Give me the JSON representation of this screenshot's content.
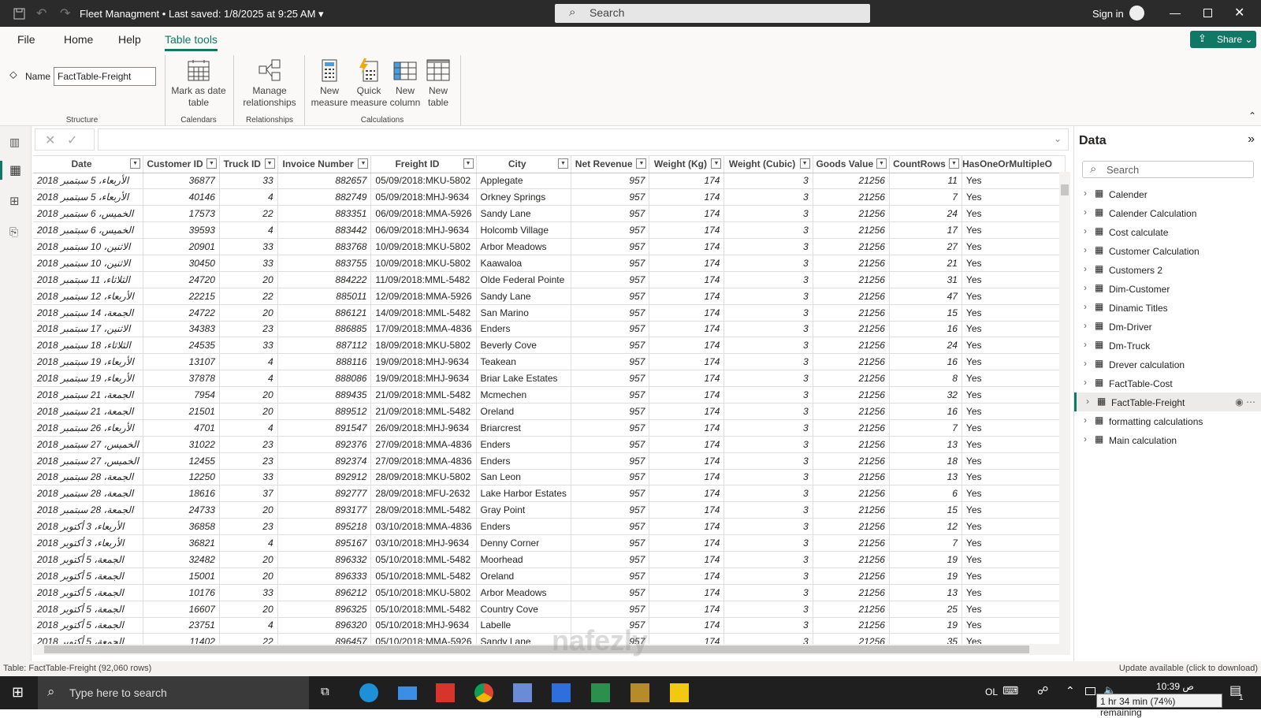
{
  "title": {
    "doc": "Fleet Managment",
    "saved": "• Last saved: 1/8/2025 at 9:25 AM",
    "search": "Search",
    "sign_in": "Sign in"
  },
  "ribbon": {
    "tabs": [
      "File",
      "Home",
      "Help",
      "Table tools"
    ],
    "active_tab": "Table tools",
    "name_label": "Name",
    "name_value": "FactTable-Freight",
    "buttons": [
      {
        "l1": "Mark as date",
        "l2": "table"
      },
      {
        "l1": "Manage",
        "l2": "relationships"
      },
      {
        "l1": "New",
        "l2": "measure"
      },
      {
        "l1": "Quick",
        "l2": "measure"
      },
      {
        "l1": "New",
        "l2": "column"
      },
      {
        "l1": "New",
        "l2": "table"
      }
    ],
    "groups": [
      "Structure",
      "Calendars",
      "Relationships",
      "Calculations"
    ],
    "share": "Share"
  },
  "table": {
    "columns": [
      "Date",
      "Customer ID",
      "Truck ID",
      "Invoice Number",
      "Freight ID",
      "City",
      "Net Revenue",
      "Weight (Kg)",
      "Weight (Cubic)",
      "Goods Value",
      "CountRows",
      "HasOneOrMultipleO"
    ],
    "rows": [
      [
        "الأربعاء، 5 سبتمبر 2018",
        "36877",
        "33",
        "882657",
        "05/09/2018:MKU-5802",
        "Applegate",
        "957",
        "174",
        "3",
        "21256",
        "11",
        "Yes"
      ],
      [
        "الأربعاء، 5 سبتمبر 2018",
        "40146",
        "4",
        "882749",
        "05/09/2018:MHJ-9634",
        "Orkney Springs",
        "957",
        "174",
        "3",
        "21256",
        "7",
        "Yes"
      ],
      [
        "الخميس، 6 سبتمبر 2018",
        "17573",
        "22",
        "883351",
        "06/09/2018:MMA-5926",
        "Sandy Lane",
        "957",
        "174",
        "3",
        "21256",
        "24",
        "Yes"
      ],
      [
        "الخميس، 6 سبتمبر 2018",
        "39593",
        "4",
        "883442",
        "06/09/2018:MHJ-9634",
        "Holcomb Village",
        "957",
        "174",
        "3",
        "21256",
        "17",
        "Yes"
      ],
      [
        "الاثنين، 10 سبتمبر 2018",
        "20901",
        "33",
        "883768",
        "10/09/2018:MKU-5802",
        "Arbor Meadows",
        "957",
        "174",
        "3",
        "21256",
        "27",
        "Yes"
      ],
      [
        "الاثنين، 10 سبتمبر 2018",
        "30450",
        "33",
        "883755",
        "10/09/2018:MKU-5802",
        "Kaawaloa",
        "957",
        "174",
        "3",
        "21256",
        "21",
        "Yes"
      ],
      [
        "الثلاثاء، 11 سبتمبر 2018",
        "24720",
        "20",
        "884222",
        "11/09/2018:MML-5482",
        "Olde Federal Pointe",
        "957",
        "174",
        "3",
        "21256",
        "31",
        "Yes"
      ],
      [
        "الأربعاء، 12 سبتمبر 2018",
        "22215",
        "22",
        "885011",
        "12/09/2018:MMA-5926",
        "Sandy Lane",
        "957",
        "174",
        "3",
        "21256",
        "47",
        "Yes"
      ],
      [
        "الجمعة، 14 سبتمبر 2018",
        "24722",
        "20",
        "886121",
        "14/09/2018:MML-5482",
        "San Marino",
        "957",
        "174",
        "3",
        "21256",
        "15",
        "Yes"
      ],
      [
        "الاثنين، 17 سبتمبر 2018",
        "34383",
        "23",
        "886885",
        "17/09/2018:MMA-4836",
        "Enders",
        "957",
        "174",
        "3",
        "21256",
        "16",
        "Yes"
      ],
      [
        "الثلاثاء، 18 سبتمبر 2018",
        "24535",
        "33",
        "887112",
        "18/09/2018:MKU-5802",
        "Beverly Cove",
        "957",
        "174",
        "3",
        "21256",
        "24",
        "Yes"
      ],
      [
        "الأربعاء، 19 سبتمبر 2018",
        "13107",
        "4",
        "888116",
        "19/09/2018:MHJ-9634",
        "Teakean",
        "957",
        "174",
        "3",
        "21256",
        "16",
        "Yes"
      ],
      [
        "الأربعاء، 19 سبتمبر 2018",
        "37878",
        "4",
        "888086",
        "19/09/2018:MHJ-9634",
        "Briar Lake Estates",
        "957",
        "174",
        "3",
        "21256",
        "8",
        "Yes"
      ],
      [
        "الجمعة، 21 سبتمبر 2018",
        "7954",
        "20",
        "889435",
        "21/09/2018:MML-5482",
        "Mcmechen",
        "957",
        "174",
        "3",
        "21256",
        "32",
        "Yes"
      ],
      [
        "الجمعة، 21 سبتمبر 2018",
        "21501",
        "20",
        "889512",
        "21/09/2018:MML-5482",
        "Oreland",
        "957",
        "174",
        "3",
        "21256",
        "16",
        "Yes"
      ],
      [
        "الأربعاء، 26 سبتمبر 2018",
        "4701",
        "4",
        "891547",
        "26/09/2018:MHJ-9634",
        "Briarcrest",
        "957",
        "174",
        "3",
        "21256",
        "7",
        "Yes"
      ],
      [
        "الخميس، 27 سبتمبر 2018",
        "31022",
        "23",
        "892376",
        "27/09/2018:MMA-4836",
        "Enders",
        "957",
        "174",
        "3",
        "21256",
        "13",
        "Yes"
      ],
      [
        "الخميس، 27 سبتمبر 2018",
        "12455",
        "23",
        "892374",
        "27/09/2018:MMA-4836",
        "Enders",
        "957",
        "174",
        "3",
        "21256",
        "18",
        "Yes"
      ],
      [
        "الجمعة، 28 سبتمبر 2018",
        "12250",
        "33",
        "892912",
        "28/09/2018:MKU-5802",
        "San Leon",
        "957",
        "174",
        "3",
        "21256",
        "13",
        "Yes"
      ],
      [
        "الجمعة، 28 سبتمبر 2018",
        "18616",
        "37",
        "892777",
        "28/09/2018:MFU-2632",
        "Lake Harbor Estates",
        "957",
        "174",
        "3",
        "21256",
        "6",
        "Yes"
      ],
      [
        "الجمعة، 28 سبتمبر 2018",
        "24733",
        "20",
        "893177",
        "28/09/2018:MML-5482",
        "Gray Point",
        "957",
        "174",
        "3",
        "21256",
        "15",
        "Yes"
      ],
      [
        "الأربعاء، 3 أكتوبر 2018",
        "36858",
        "23",
        "895218",
        "03/10/2018:MMA-4836",
        "Enders",
        "957",
        "174",
        "3",
        "21256",
        "12",
        "Yes"
      ],
      [
        "الأربعاء، 3 أكتوبر 2018",
        "36821",
        "4",
        "895167",
        "03/10/2018:MHJ-9634",
        "Denny Corner",
        "957",
        "174",
        "3",
        "21256",
        "7",
        "Yes"
      ],
      [
        "الجمعة، 5 أكتوبر 2018",
        "32482",
        "20",
        "896332",
        "05/10/2018:MML-5482",
        "Moorhead",
        "957",
        "174",
        "3",
        "21256",
        "19",
        "Yes"
      ],
      [
        "الجمعة، 5 أكتوبر 2018",
        "15001",
        "20",
        "896333",
        "05/10/2018:MML-5482",
        "Oreland",
        "957",
        "174",
        "3",
        "21256",
        "19",
        "Yes"
      ],
      [
        "الجمعة، 5 أكتوبر 2018",
        "10176",
        "33",
        "896212",
        "05/10/2018:MKU-5802",
        "Arbor Meadows",
        "957",
        "174",
        "3",
        "21256",
        "13",
        "Yes"
      ],
      [
        "الجمعة، 5 أكتوبر 2018",
        "16607",
        "20",
        "896325",
        "05/10/2018:MML-5482",
        "Country Cove",
        "957",
        "174",
        "3",
        "21256",
        "25",
        "Yes"
      ],
      [
        "الجمعة، 5 أكتوبر 2018",
        "23751",
        "4",
        "896320",
        "05/10/2018:MHJ-9634",
        "Labelle",
        "957",
        "174",
        "3",
        "21256",
        "19",
        "Yes"
      ],
      [
        "الجمعة، 5 أكتوبر 2018",
        "11402",
        "22",
        "896457",
        "05/10/2018:MMA-5926",
        "Sandy Lane",
        "957",
        "174",
        "3",
        "21256",
        "35",
        "Yes"
      ]
    ]
  },
  "data_pane": {
    "title": "Data",
    "search_placeholder": "Search",
    "selected": "FactTable-Freight",
    "items": [
      "Calender",
      "Calender Calculation",
      "Cost calculate",
      "Customer Calculation",
      "Customers 2",
      "Dim-Customer",
      "Dinamic Titles",
      "Dm-Driver",
      "Dm-Truck",
      "Drever calculation",
      "FactTable-Cost",
      "FactTable-Freight",
      "formatting calculations",
      "Main calculation"
    ]
  },
  "status": {
    "left": "Table: FactTable-Freight (92,060 rows)",
    "right": "Update available (click to download)"
  },
  "taskbar": {
    "search": "Type here to search",
    "lang": "OL",
    "time": "10:39 ص",
    "battery_tooltip": "1 hr 34 min (74%) remaining",
    "notifications": "1"
  },
  "watermark": "nafezly.com",
  "colors": {
    "accent": "#117865",
    "titlebar": "#2b2b2b"
  }
}
